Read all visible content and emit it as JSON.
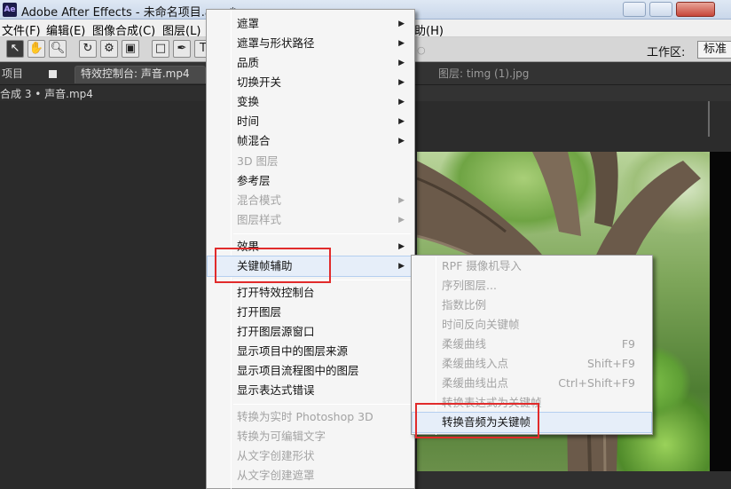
{
  "window": {
    "title": "Adobe After Effects - 未命名项目.aep *",
    "app_icon": "Ae"
  },
  "menubar": {
    "items": [
      "文件(F)",
      "编辑(E)",
      "图像合成(C)",
      "图层(L)",
      "助(H)"
    ]
  },
  "toolbar": {
    "tools": [
      "selection-tool",
      "hand-tool",
      "zoom-tool",
      "rotate-tool",
      "camera-tool",
      "rectangle-tool",
      "pen-tool",
      "text-tool"
    ],
    "workspace_label": "工作区:",
    "workspace_value": "标准"
  },
  "panels": {
    "project_tab": "项目",
    "effect_controls_tab": "特效控制台: 声音.mp4",
    "layer_tab": "图层: timg (1).jpg",
    "comp_breadcrumb": "合成 3 • 声音.mp4"
  },
  "context_menu": {
    "items": [
      {
        "label": "遮罩",
        "submenu": true,
        "enabled": true
      },
      {
        "label": "遮罩与形状路径",
        "submenu": true,
        "enabled": true
      },
      {
        "label": "品质",
        "submenu": true,
        "enabled": true
      },
      {
        "label": "切换开关",
        "submenu": true,
        "enabled": true
      },
      {
        "label": "变换",
        "submenu": true,
        "enabled": true
      },
      {
        "label": "时间",
        "submenu": true,
        "enabled": true
      },
      {
        "label": "帧混合",
        "submenu": true,
        "enabled": true
      },
      {
        "label": "3D 图层",
        "submenu": false,
        "enabled": false
      },
      {
        "label": "参考层",
        "submenu": false,
        "enabled": true
      },
      {
        "label": "混合模式",
        "submenu": true,
        "enabled": false
      },
      {
        "label": "图层样式",
        "submenu": true,
        "enabled": false
      },
      {
        "label": "效果",
        "submenu": true,
        "enabled": true
      },
      {
        "label": "关键帧辅助",
        "submenu": true,
        "enabled": true,
        "highlighted": true
      },
      {
        "label": "打开特效控制台",
        "submenu": false,
        "enabled": true
      },
      {
        "label": "打开图层",
        "submenu": false,
        "enabled": true
      },
      {
        "label": "打开图层源窗口",
        "submenu": false,
        "enabled": true
      },
      {
        "label": "显示项目中的图层来源",
        "submenu": false,
        "enabled": true
      },
      {
        "label": "显示项目流程图中的图层",
        "submenu": false,
        "enabled": true
      },
      {
        "label": "显示表达式错误",
        "submenu": false,
        "enabled": true
      },
      {
        "label": "转换为实时 Photoshop 3D",
        "submenu": false,
        "enabled": false
      },
      {
        "label": "转换为可编辑文字",
        "submenu": false,
        "enabled": false
      },
      {
        "label": "从文字创建形状",
        "submenu": false,
        "enabled": false
      },
      {
        "label": "从文字创建遮罩",
        "submenu": false,
        "enabled": false
      }
    ]
  },
  "keyframe_assistant_submenu": {
    "items": [
      {
        "label": "RPF 摄像机导入",
        "shortcut": "",
        "enabled": false
      },
      {
        "label": "序列图层...",
        "shortcut": "",
        "enabled": false
      },
      {
        "label": "指数比例",
        "shortcut": "",
        "enabled": false
      },
      {
        "label": "时间反向关键帧",
        "shortcut": "",
        "enabled": false
      },
      {
        "label": "柔缓曲线",
        "shortcut": "F9",
        "enabled": false
      },
      {
        "label": "柔缓曲线入点",
        "shortcut": "Shift+F9",
        "enabled": false
      },
      {
        "label": "柔缓曲线出点",
        "shortcut": "Ctrl+Shift+F9",
        "enabled": false
      },
      {
        "label": "转换表达式为关键帧",
        "shortcut": "",
        "enabled": false
      },
      {
        "label": "转换音频为关键帧",
        "shortcut": "",
        "enabled": true,
        "highlighted": true
      }
    ]
  },
  "colors": {
    "annotation_red": "#e12b2b",
    "menu_bg": "#f5f5f5",
    "disabled_text": "#a3a3a3",
    "app_dark_bg": "#2b2b2b"
  }
}
